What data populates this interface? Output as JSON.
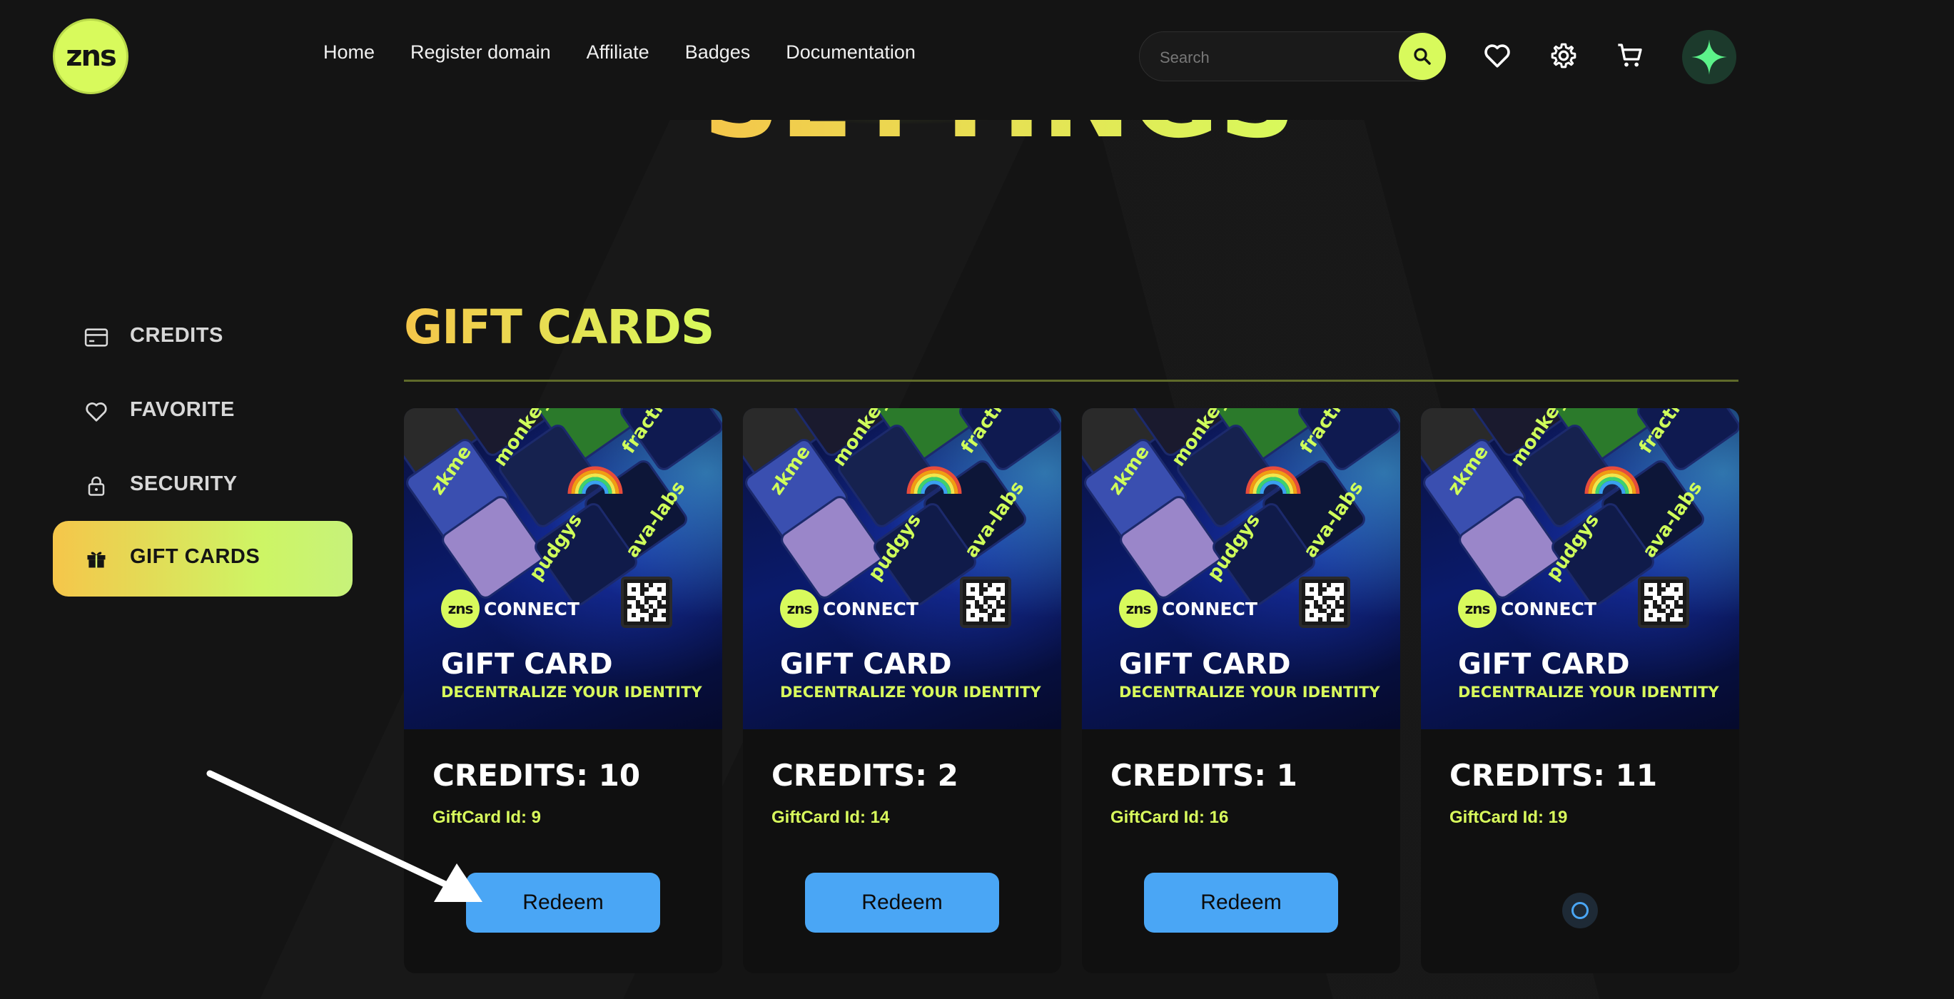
{
  "header": {
    "logo_text": "zns",
    "nav": [
      "Home",
      "Register domain",
      "Affiliate",
      "Badges",
      "Documentation"
    ],
    "search_placeholder": "Search",
    "icons": [
      "search-icon",
      "heart-icon",
      "gear-icon",
      "cart-icon",
      "sparkle-avatar-icon"
    ],
    "settings_title": "SETTINGS"
  },
  "sidebar": {
    "items": [
      {
        "label": "CREDITS",
        "icon": "credit-card-icon"
      },
      {
        "label": "FAVORITE",
        "icon": "heart-icon"
      },
      {
        "label": "SECURITY",
        "icon": "lock-icon"
      },
      {
        "label": "GIFT CARDS",
        "icon": "gift-icon",
        "active": true
      }
    ]
  },
  "main": {
    "title": "GIFT CARDS",
    "card_art": {
      "tile_labels": [
        "zkme",
        "monkey",
        "fraction",
        "pudgys",
        "ava-labs"
      ],
      "brand": "zns",
      "connect": "CONNECT",
      "title": "GIFT CARD",
      "subtitle": "DECENTRALIZE YOUR IDENTITY"
    },
    "cards": [
      {
        "credits": "CREDITS: 10",
        "id": "GiftCard Id: 9",
        "button": "Redeem"
      },
      {
        "credits": "CREDITS: 2",
        "id": "GiftCard Id: 14",
        "button": "Redeem"
      },
      {
        "credits": "CREDITS: 1",
        "id": "GiftCard Id: 16",
        "button": "Redeem"
      },
      {
        "credits": "CREDITS: 11",
        "id": "GiftCard Id: 19",
        "button": null,
        "loading": true
      }
    ]
  },
  "colors": {
    "accent_lime": "#d8fa5c",
    "accent_gold": "#f5c64a",
    "button_blue": "#4aa6f5",
    "background": "#141414"
  }
}
